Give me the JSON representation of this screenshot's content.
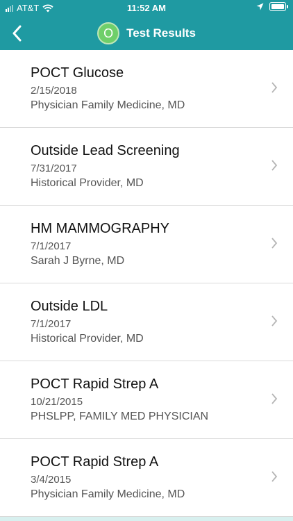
{
  "status_bar": {
    "carrier": "AT&T",
    "time": "11:52 AM"
  },
  "header": {
    "avatar_initial": "O",
    "title": "Test Results"
  },
  "results": [
    {
      "name": "POCT Glucose",
      "date": "2/15/2018",
      "provider": "Physician Family Medicine, MD"
    },
    {
      "name": "Outside Lead Screening",
      "date": "7/31/2017",
      "provider": "Historical Provider, MD"
    },
    {
      "name": "HM MAMMOGRAPHY",
      "date": "7/1/2017",
      "provider": "Sarah J Byrne, MD"
    },
    {
      "name": "Outside LDL",
      "date": "7/1/2017",
      "provider": "Historical Provider, MD"
    },
    {
      "name": "POCT Rapid Strep A",
      "date": "10/21/2015",
      "provider": "PHSLPP, FAMILY MED PHYSICIAN"
    },
    {
      "name": "POCT Rapid Strep A",
      "date": "3/4/2015",
      "provider": "Physician Family Medicine, MD"
    }
  ],
  "icons": {
    "back": "chevron-left-icon",
    "row_chevron": "chevron-right-icon"
  },
  "colors": {
    "header_bg": "#1f9aa2",
    "avatar_bg": "#6fcf6a"
  }
}
